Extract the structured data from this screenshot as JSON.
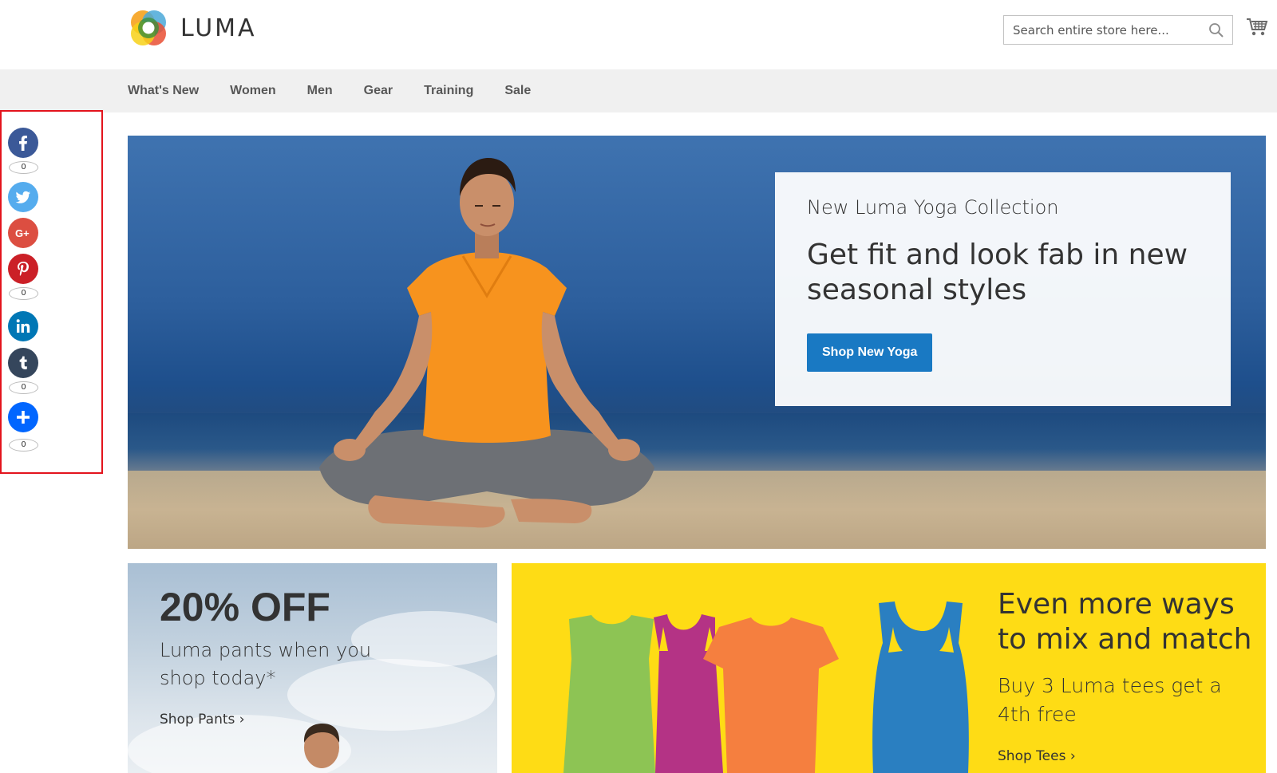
{
  "header": {
    "logo_text": "LUMA",
    "search_placeholder": "Search entire store here..."
  },
  "nav": {
    "items": [
      "What's New",
      "Women",
      "Men",
      "Gear",
      "Training",
      "Sale"
    ]
  },
  "share": {
    "facebook_count": "0",
    "pinterest_count": "0",
    "tumblr_count": "0",
    "addtoany_count": "0",
    "colors": {
      "facebook": "#3b5998",
      "twitter": "#55acee",
      "googleplus": "#dc4e41",
      "pinterest": "#cb2027",
      "linkedin": "#0077b5",
      "tumblr": "#35465c",
      "addtoany": "#0166ff",
      "panel_border": "#e3141d"
    }
  },
  "hero": {
    "kicker": "New Luma Yoga Collection",
    "title": "Get fit and look fab in new seasonal styles",
    "button": "Shop New Yoga"
  },
  "pants_block": {
    "title": "20% OFF",
    "text": "Luma pants when you shop today*",
    "link": "Shop Pants ›"
  },
  "tees_block": {
    "title": "Even more ways to mix and match",
    "text": "Buy 3 Luma tees get a 4th free",
    "link": "Shop Tees ›",
    "background": "#fedc15"
  },
  "accent": "#1979c3"
}
